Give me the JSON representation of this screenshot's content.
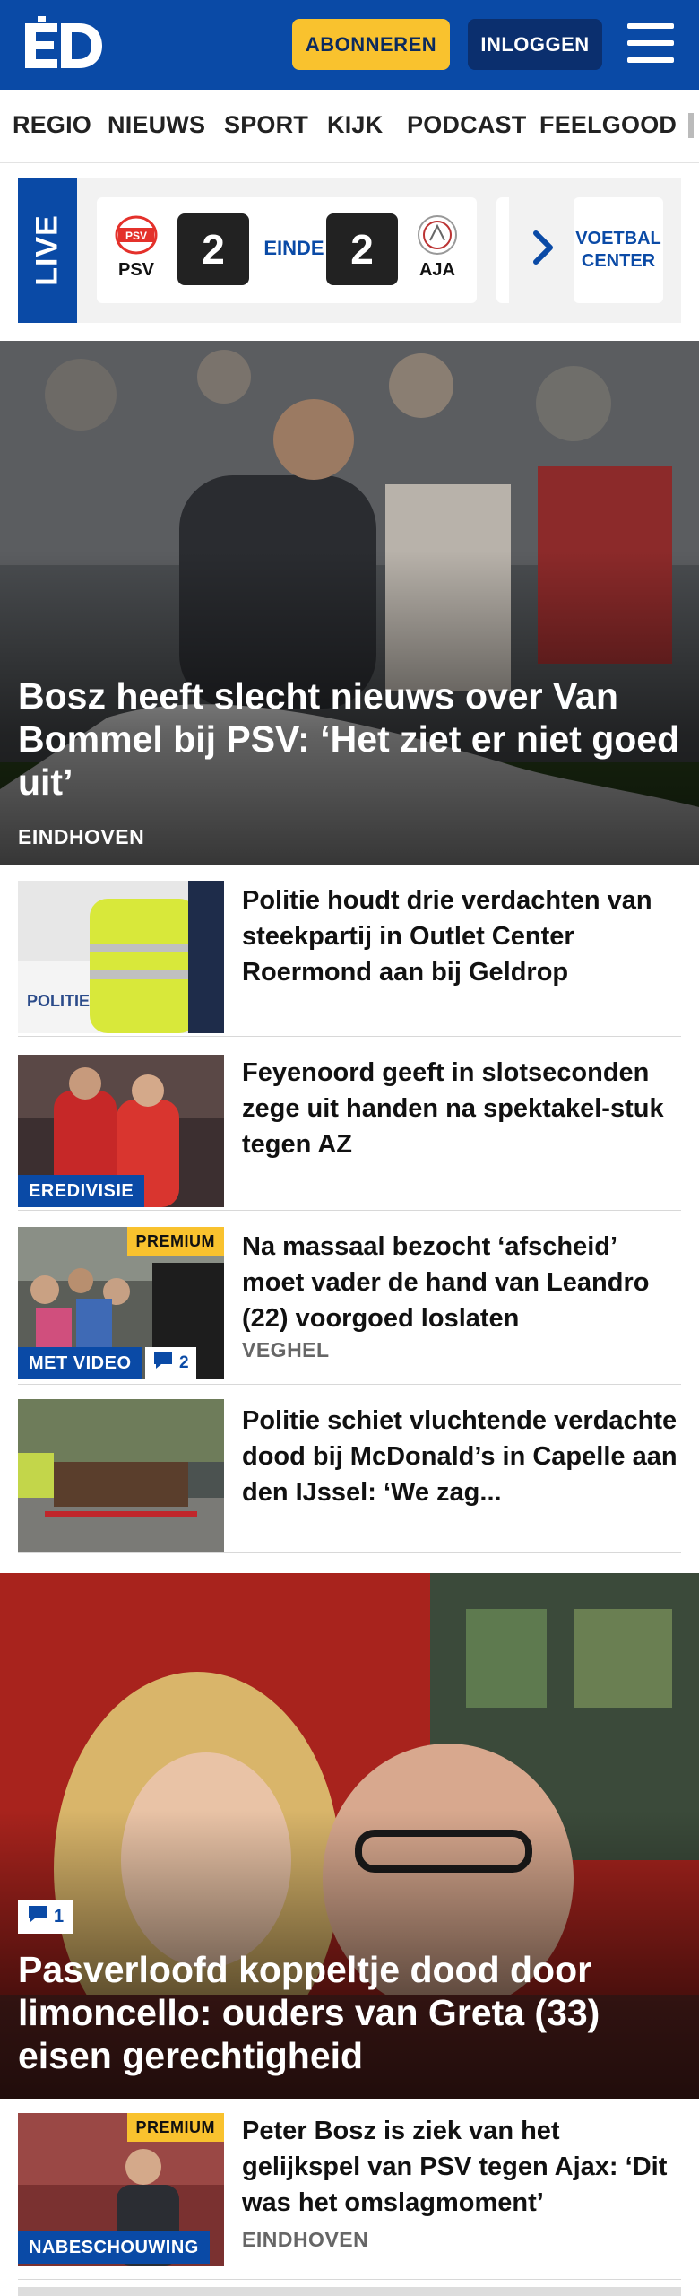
{
  "header": {
    "logo": "ED",
    "subscribe_label": "ABONNEREN",
    "login_label": "INLOGGEN",
    "brand_color": "#0a4aa6",
    "accent_color": "#f9c22e"
  },
  "nav": {
    "items": [
      "REGIO",
      "NIEUWS",
      "SPORT",
      "KIJK",
      "PODCAST",
      "FEELGOOD"
    ]
  },
  "live": {
    "tag": "LIVE",
    "home_team": "PSV",
    "away_team": "AJA",
    "home_score": "2",
    "away_score": "2",
    "status": "EINDE",
    "voetbal_center": "VOETBAL CENTER"
  },
  "hero": {
    "title": "Bosz heeft slecht nieuws over Van Bommel bij PSV: ‘Het ziet er niet goed uit’",
    "location": "EINDHOVEN"
  },
  "articles": [
    {
      "title": "Politie houdt drie verdachten van steekpartij in Outlet Center Roermond aan bij Geldrop",
      "location": "",
      "tag": "",
      "premium": "",
      "comments": ""
    },
    {
      "title": "Feyenoord geeft in slotseconden zege uit handen na spektakel-stuk tegen AZ",
      "location": "",
      "tag": "EREDIVISIE",
      "premium": "",
      "comments": ""
    },
    {
      "title": "Na massaal bezocht ‘afscheid’ moet vader de hand van Leandro (22) voorgoed loslaten",
      "location": "VEGHEL",
      "tag": "MET VIDEO",
      "premium": "PREMIUM",
      "comments": "2"
    },
    {
      "title": "Politie schiet vluchtende verdachte dood bij McDonald’s in Capelle aan den IJssel: ‘We zag...",
      "location": "",
      "tag": "",
      "premium": "",
      "comments": ""
    }
  ],
  "big_story": {
    "title": "Pasverloofd koppeltje dood door limoncello: ouders van Greta (33) eisen gerechtigheid",
    "comments": "1"
  },
  "last_article": {
    "title": "Peter Bosz is ziek van het gelijkspel van PSV tegen Ajax: ‘Dit was het omslagmoment’",
    "location": "EINDHOVEN",
    "tag": "NABESCHOUWING",
    "premium": "PREMIUM"
  }
}
